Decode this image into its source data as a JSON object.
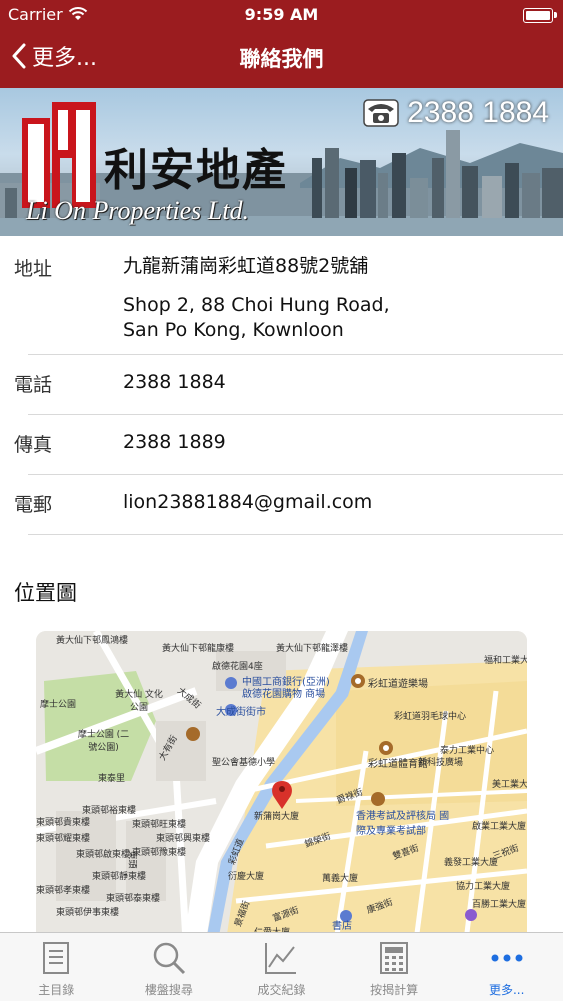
{
  "status_bar": {
    "carrier": "Carrier",
    "time": "9:59 AM"
  },
  "nav": {
    "back_label": "更多...",
    "title": "聯絡我們"
  },
  "banner": {
    "phone": "2388 1884",
    "company_cn": "利安地產",
    "company_en": "Li On Properties Ltd."
  },
  "contact": {
    "address_label": "地址",
    "address_cn": "九龍新蒲崗彩虹道88號2號舖",
    "address_en_line1": "Shop 2, 88 Choi Hung Road,",
    "address_en_line2": "San Po Kong, Kownloon",
    "phone_label": "電話",
    "phone_value": "2388 1884",
    "fax_label": "傳真",
    "fax_value": "2388 1889",
    "email_label": "電郵",
    "email_value": "lion23881884@gmail.com"
  },
  "map_section": {
    "title": "位置圖",
    "labels": {
      "l1": "黃大仙下邨鳳鴻樓",
      "l2": "黃大仙下邨龍康樓",
      "l3": "黃大仙下邨龍澤樓",
      "l4": "啟德花園4座",
      "l5": "中國工商銀行(亞洲)",
      "l6": "啟德花園購物 商場",
      "l7": "彩虹道遊樂場",
      "l8": "福和工業大",
      "l9": "黃大仙 文化公園",
      "l10": "摩士公園",
      "l11": "大成街街市",
      "l12": "彩虹道羽毛球中心",
      "l13": "摩士公園 (二號公園)",
      "l14": "聖公會基德小學",
      "l15": "彩虹道體育館",
      "l16": "泰力工業中心",
      "l17": "東泰里",
      "l18": "新科技廣場",
      "l19": "美工業大",
      "l20": "新蒲崗大廈",
      "l21": "香港考試及評核局 國際及專業考試部",
      "l22": "東頭邨裕東樓",
      "l23": "東頭邨貴東樓",
      "l24": "東頭邨旺東樓",
      "l25": "東頭邨耀東樓",
      "l26": "啟業工業大廈",
      "l27": "義發工業大廈",
      "l28": "東頭邨興東樓",
      "l29": "衍慶大廈",
      "l30": "萬義大廈",
      "l31": "協力工業大廈",
      "l32": "東頭邨啟東樓",
      "l33": "百勝工業大廈",
      "l34": "東頭邨豫東樓",
      "l35": "東頭邨靜東樓",
      "l36": "東頭邨孝東樓",
      "l37": "東頭邨泰東樓",
      "l38": "仁愛大廈",
      "l39": "東頭邨伊事東樓",
      "l40": "書店",
      "s1": "大成街",
      "s2": "爵祿街",
      "s3": "錦榮街",
      "s4": "雙喜街",
      "s5": "大有街",
      "s6": "彩虹道",
      "s7": "東頭",
      "s8": "景福街",
      "s9": "富源街",
      "s10": "康強街",
      "s11": "三祝街"
    }
  },
  "tabbar": {
    "tabs": [
      {
        "label": "主目錄"
      },
      {
        "label": "樓盤搜尋"
      },
      {
        "label": "成交紀錄"
      },
      {
        "label": "按揭計算"
      },
      {
        "label": "更多..."
      }
    ]
  },
  "colors": {
    "brand_red": "#9b1c1f",
    "active_tab": "#1e6ee0",
    "inactive_tab": "#8a8a8a"
  }
}
